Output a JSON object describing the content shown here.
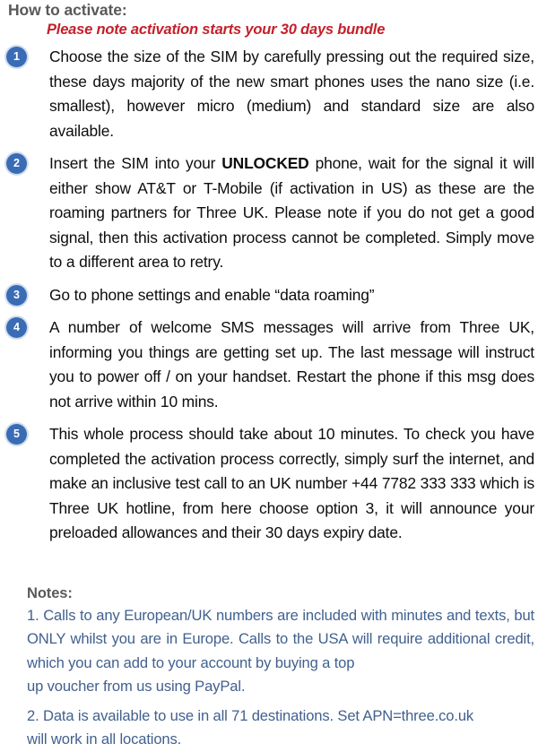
{
  "document": {
    "title": "How to activate:",
    "subtitle": "Please note activation starts your 30 days bundle",
    "colors": {
      "title_gray": "#595959",
      "subtitle_red": "#c4202a",
      "badge_blue": "#3a6cb5",
      "note_blue": "#41618f",
      "body_black": "#0d0d0d",
      "background": "#ffffff"
    },
    "steps": [
      {
        "number": "1",
        "text_before_bold": "Choose the size of the SIM by carefully pressing out the required size, these days majority of the new smart phones uses the nano size (i.e. smallest), however micro (medium) and standard size are also available.",
        "bold": "",
        "text_after_bold": ""
      },
      {
        "number": "2",
        "text_before_bold": "Insert the SIM into your ",
        "bold": "UNLOCKED",
        "text_after_bold": " phone, wait for the signal it will either show AT&T or T-Mobile (if activation in US) as these are the roaming partners for Three UK. Please note if you do not get a good signal, then this activation process cannot be completed. Simply move to a different area to retry."
      },
      {
        "number": "3",
        "text_before_bold": "Go to phone settings and enable “data roaming”",
        "bold": "",
        "text_after_bold": ""
      },
      {
        "number": "4",
        "text_before_bold": "A number of welcome SMS messages will arrive from Three UK, informing you things are getting set up. The last message will instruct you to power off / on your handset. Restart the phone if this msg does not arrive within 10 mins.",
        "bold": "",
        "text_after_bold": ""
      },
      {
        "number": "5",
        "text_before_bold": "This whole process should take about 10 minutes. To check you have completed the activation process correctly, simply surf the internet, and make an inclusive test call to an UK number +44 7782 333 333 which is Three UK hotline, from here choose option 3, it will announce your preloaded allowances and their 30 days expiry date.",
        "bold": "",
        "text_after_bold": ""
      }
    ],
    "notes": {
      "heading": "Notes:",
      "items": [
        {
          "body": "1. Calls to any European/UK numbers are included with minutes and texts, but ONLY whilst you are in Europe. Calls to the USA will require additional credit, which you can add to your account by buying a top",
          "last_line": "up voucher from us  using PayPal."
        },
        {
          "body": "2. Data is available to use in all 71 destinations. Set APN=three.co.uk",
          "last_line": "will work in all locations."
        }
      ]
    }
  }
}
